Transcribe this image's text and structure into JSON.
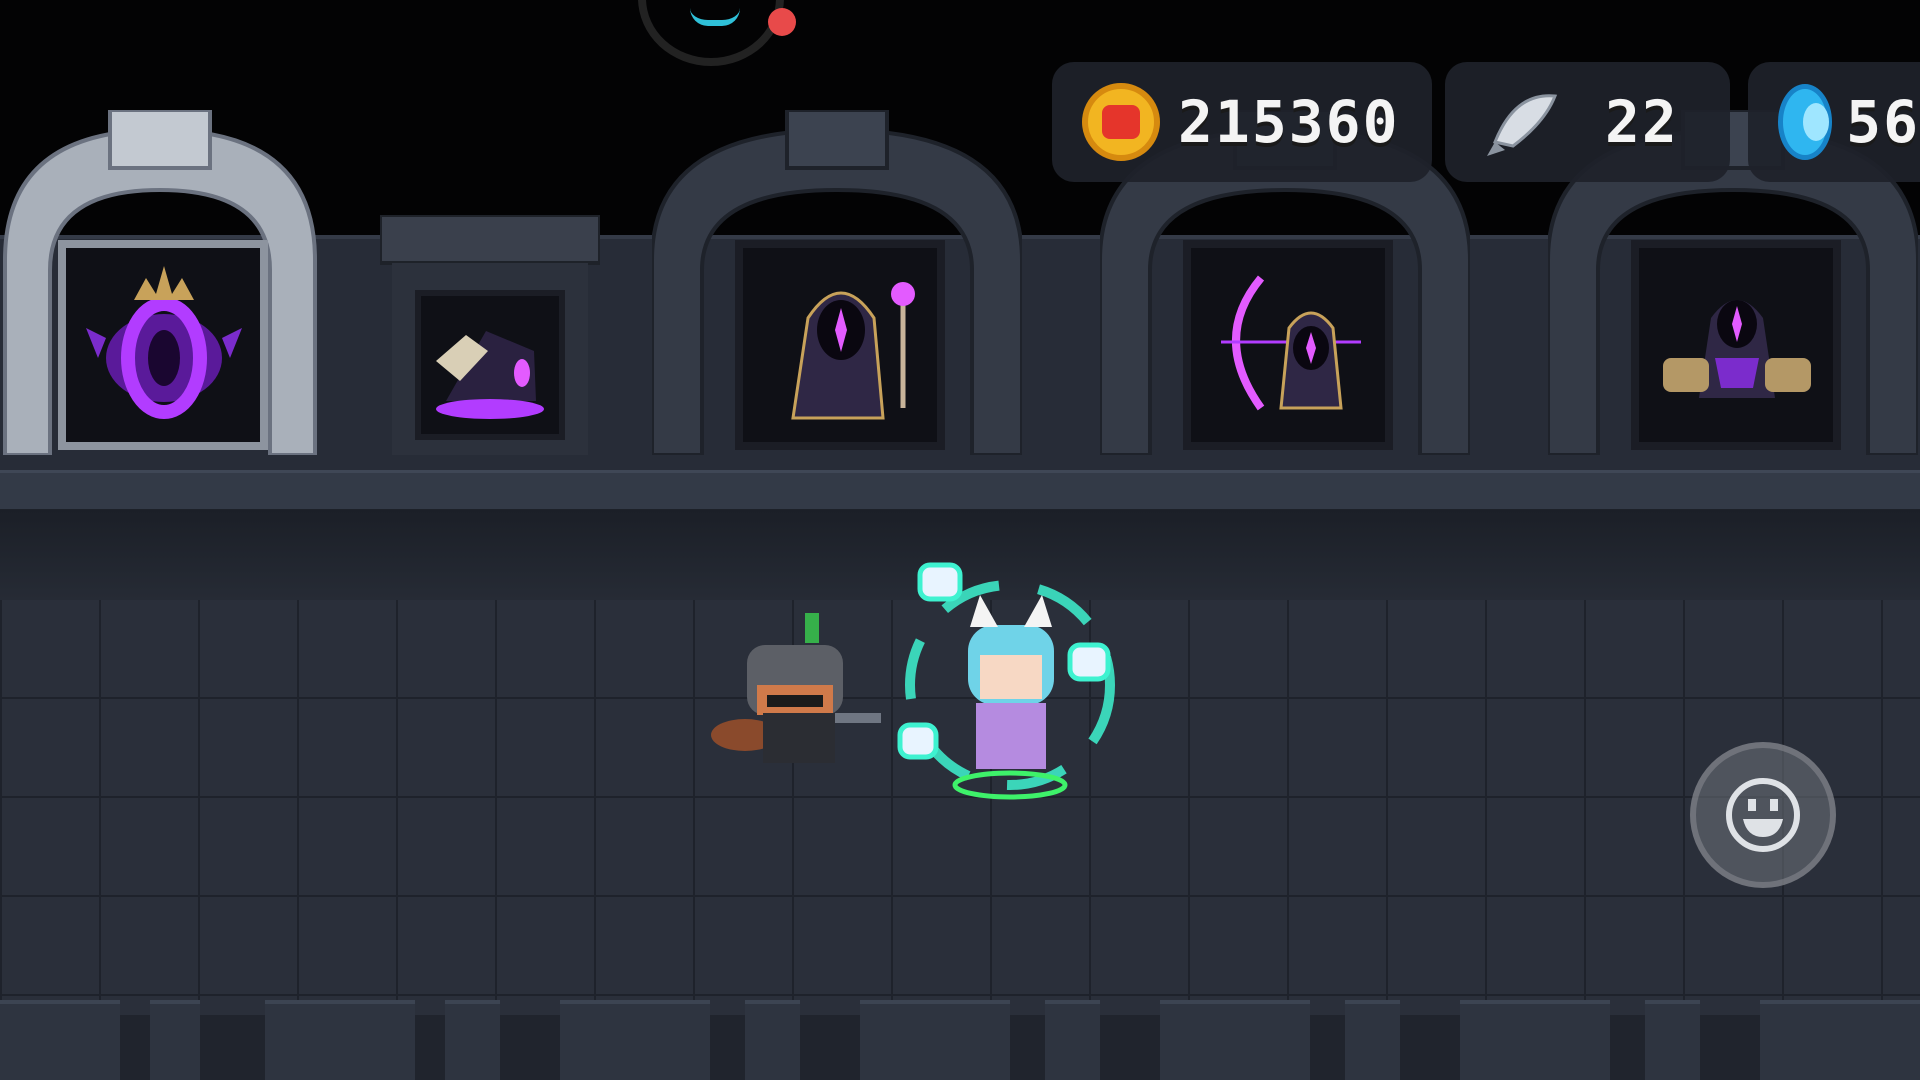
{
  "hud": {
    "gold": {
      "value": "215360",
      "icon": "gold-coin-icon"
    },
    "fish": {
      "value": "22",
      "icon": "fish-icon"
    },
    "gems": {
      "value": "56",
      "icon": "blue-gem-icon"
    }
  },
  "displays": [
    {
      "name": "void-portal-skin",
      "lit": true
    },
    {
      "name": "dark-wizard-hat",
      "lit": false
    },
    {
      "name": "hooded-mage-with-staff",
      "lit": false
    },
    {
      "name": "hooded-archer-with-bow",
      "lit": false
    },
    {
      "name": "hooded-rogue-with-gauntlets",
      "lit": false
    }
  ],
  "characters": [
    "raccoon-knight",
    "cat-eared-priestess"
  ],
  "controls": {
    "emote": "smile-face-icon"
  },
  "colors": {
    "accent_purple": "#b23cff",
    "coin_gold": "#f2b521",
    "gem_blue": "#2fb6f0",
    "aura_cyan": "#3ef2d0"
  }
}
